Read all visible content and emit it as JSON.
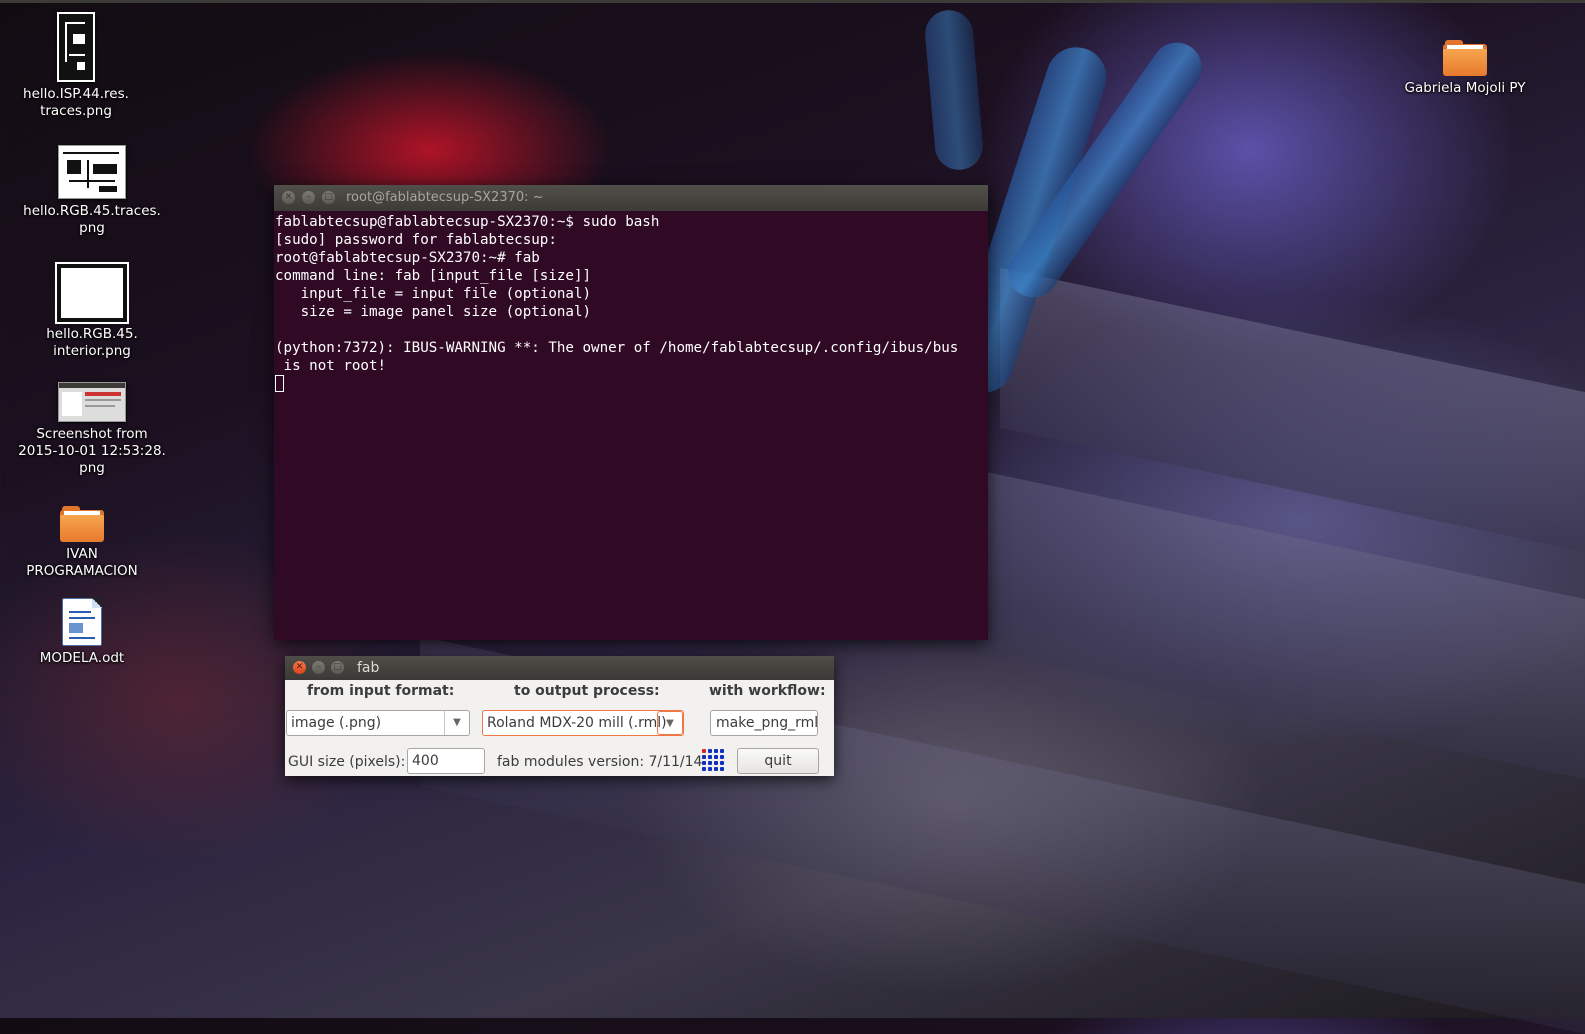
{
  "desktop": {
    "icons": [
      {
        "label": "hello.ISP.44.res.\ntraces.png"
      },
      {
        "label": "hello.RGB.45.traces.\npng"
      },
      {
        "label": "hello.RGB.45.\ninterior.png"
      },
      {
        "label": "Screenshot from\n2015-10-01 12:53:28.\npng"
      },
      {
        "label": "IVAN\nPROGRAMACION"
      },
      {
        "label": "MODELA.odt"
      },
      {
        "label": "Gabriela Mojoli PY"
      }
    ]
  },
  "terminal": {
    "title": "root@fablabtecsup-SX2370: ~",
    "lines": [
      "fablabtecsup@fablabtecsup-SX2370:~$ sudo bash",
      "[sudo] password for fablabtecsup:",
      "root@fablabtecsup-SX2370:~# fab",
      "command line: fab [input_file [size]]",
      "   input_file = input file (optional)",
      "   size = image panel size (optional)",
      "",
      "(python:7372): IBUS-WARNING **: The owner of /home/fablabtecsup/.config/ibus/bus",
      " is not root!"
    ]
  },
  "fab": {
    "title": "fab",
    "from_label": "from input format:",
    "to_label": "to output process:",
    "workflow_label": "with workflow:",
    "input_format": "image (.png)",
    "output_process": "Roland MDX-20 mill (.rml)",
    "workflow": "make_png_rml",
    "gui_size_label": "GUI size (pixels):",
    "gui_size_value": "400",
    "version_label": "fab modules version: 7/11/14",
    "quit_label": "quit"
  },
  "colors": {
    "terminal_bg": "#300a24",
    "accent_orange": "#f07746"
  }
}
